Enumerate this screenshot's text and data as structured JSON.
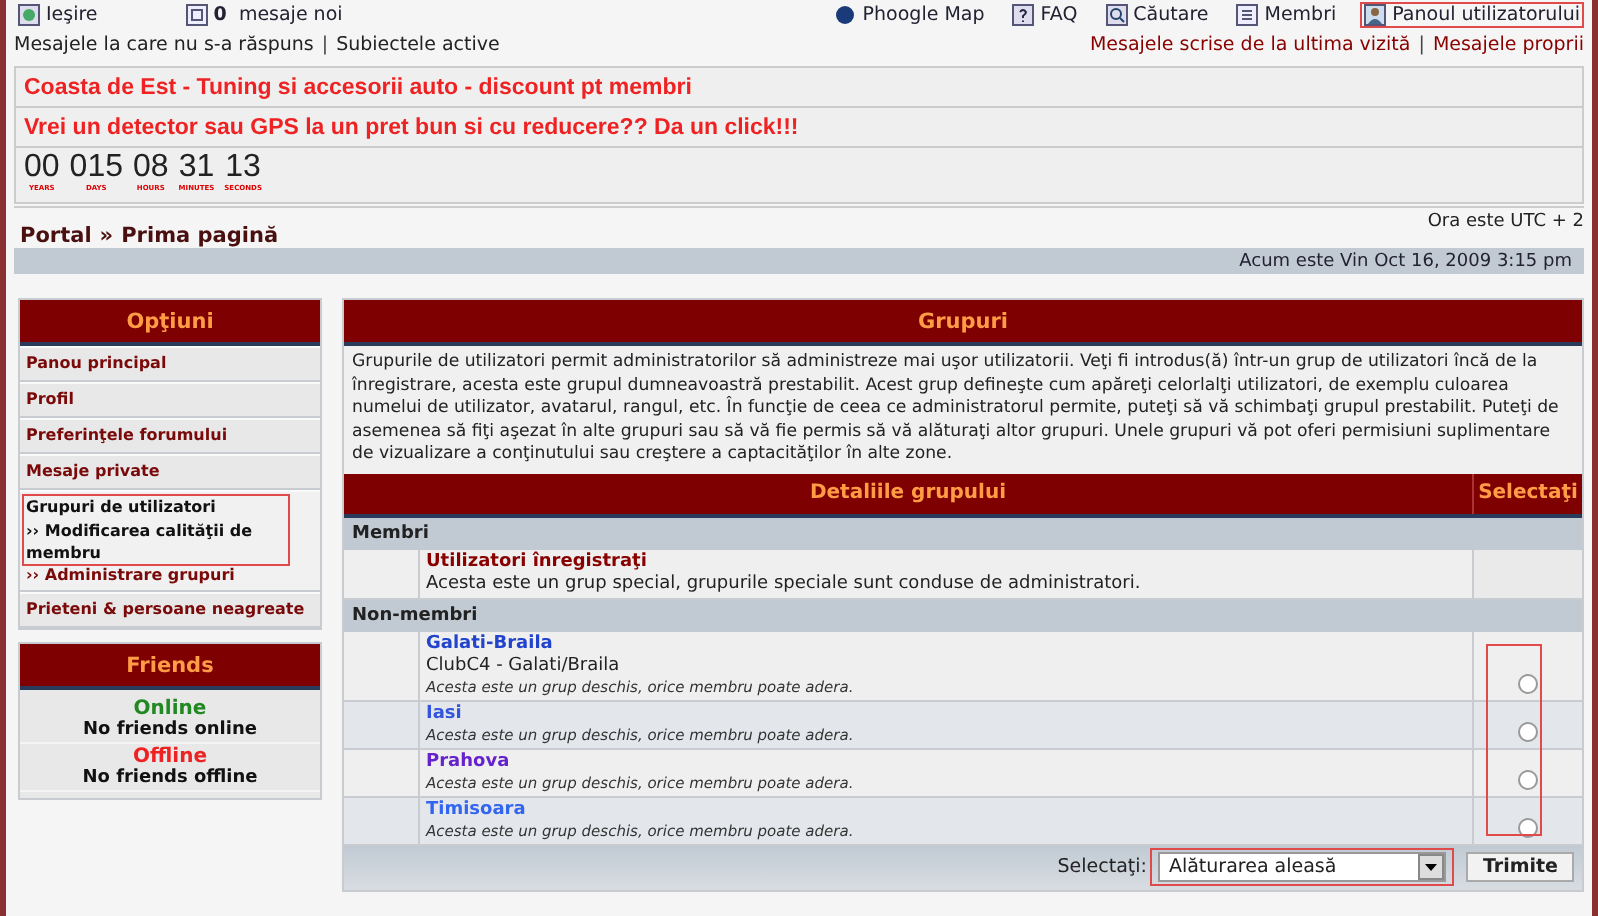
{
  "top_links": [
    {
      "kind": "logout",
      "label": "Ieşire",
      "highlighted": false
    },
    {
      "kind": "messages",
      "count": "0",
      "label": "mesaje noi",
      "highlighted": false
    }
  ],
  "top_sublinks": [
    "Mesajele la care nu s-a răspuns",
    "|",
    "Subiectele active"
  ],
  "top_right_links": [
    {
      "kind": "globe",
      "label": "Phoogle Map",
      "highlighted": false
    },
    {
      "kind": "faq",
      "label": "FAQ",
      "highlighted": false
    },
    {
      "kind": "search",
      "label": "Căutare",
      "highlighted": false
    },
    {
      "kind": "members",
      "label": "Membri",
      "highlighted": false
    },
    {
      "kind": "profile",
      "label": "Panoul utilizatorului",
      "highlighted": true
    }
  ],
  "top_right_sublinks": [
    "Mesajele scrise de la ultima vizită",
    "|",
    "Mesajele proprii"
  ],
  "banners": [
    "Coasta de Est - Tuning si accesorii auto - discount pt membri",
    "Vrei un detector sau GPS la un pret bun si cu reducere?? Da un click!!!"
  ],
  "countdown": [
    {
      "value": "00",
      "unit": "YEARS"
    },
    {
      "value": "015",
      "unit": "DAYS"
    },
    {
      "value": "08",
      "unit": "HOURS"
    },
    {
      "value": "31",
      "unit": "MINUTES"
    },
    {
      "value": "13",
      "unit": "SECONDS"
    }
  ],
  "breadcrumb": [
    "Portal",
    "»",
    "Prima pagină"
  ],
  "timezone": "Ora este UTC + 2",
  "current_time": "Acum este Vin Oct 16, 2009 3:15 pm",
  "sidebar": {
    "title": "Opţiuni",
    "items": [
      {
        "label": "Panou principal",
        "selected": false
      },
      {
        "label": "Profil",
        "selected": false
      },
      {
        "label": "Preferinţele forumului",
        "selected": false
      },
      {
        "label": "Mesaje private",
        "selected": false
      },
      {
        "label": "Grupuri de utilizatori",
        "selected": true,
        "highlighted": true,
        "children": [
          {
            "bullet": "››",
            "label": "Modificarea calităţii de membru",
            "selected": true
          },
          {
            "bullet": "››",
            "label": "Administrare grupuri",
            "selected": false
          }
        ]
      },
      {
        "label": "Prieteni & persoane neagreate",
        "selected": false
      }
    ]
  },
  "friends": {
    "title": "Friends",
    "sections": [
      {
        "label": "Online",
        "color": "#228822",
        "text": "No friends online"
      },
      {
        "label": "Offline",
        "color": "#ee2222",
        "text": "No friends offline"
      }
    ]
  },
  "panel": {
    "title": "Grupuri",
    "description": "Grupurile de utilizatori permit administratorilor să administreze mai uşor utilizatorii. Veţi fi introdus(ă) într-un grup de utilizatori încă de la înregistrare, acesta este grupul dumneavoastră prestabilit. Acest grup defineşte cum apăreţi celorlalţi utilizatori, de exemplu culoarea numelui de utilizator, avatarul, rangul, etc. În funcţie de ceea ce administratorul permite, puteţi să vă schimbaţi grupul prestabilit. Puteţi de asemenea să fiţi aşezat în alte grupuri sau să vă fie permis să vă alăturaţi altor grupuri. Unele grupuri vă pot oferi permisiuni suplimentare de vizualizare a conţinutului sau creştere a captacităţilor în alte zone.",
    "columns": [
      "Detaliile grupului",
      "Selectaţi"
    ],
    "sections": [
      {
        "title": "Membri",
        "groups": [
          {
            "name": "Utilizatori înregistraţi",
            "color": "#880000",
            "description": "Acesta este un grup special, grupurile speciale sunt conduse de administratori.",
            "selectable": false
          }
        ]
      },
      {
        "title": "Non-membri",
        "groups": [
          {
            "name": "Galati-Braila",
            "color": "#2244cc",
            "subtitle": "ClubC4 - Galati/Braila",
            "note": "Acesta este un grup deschis, orice membru poate adera.",
            "selectable": true,
            "selected": false
          },
          {
            "name": "Iasi",
            "color": "#3355dd",
            "note": "Acesta este un grup deschis, orice membru poate adera.",
            "selectable": true,
            "selected": false
          },
          {
            "name": "Prahova",
            "color": "#6622cc",
            "note": "Acesta este un grup deschis, orice membru poate adera.",
            "selectable": true,
            "selected": false
          },
          {
            "name": "Timisoara",
            "color": "#3366ee",
            "note": "Acesta este un grup deschis, orice membru poate adera.",
            "selectable": true,
            "selected": false
          }
        ]
      }
    ],
    "radios_highlighted": true,
    "footer": {
      "label": "Selectaţi:",
      "select_value": "Alăturarea aleasă",
      "select_highlighted": true,
      "button": "Trimite"
    }
  }
}
